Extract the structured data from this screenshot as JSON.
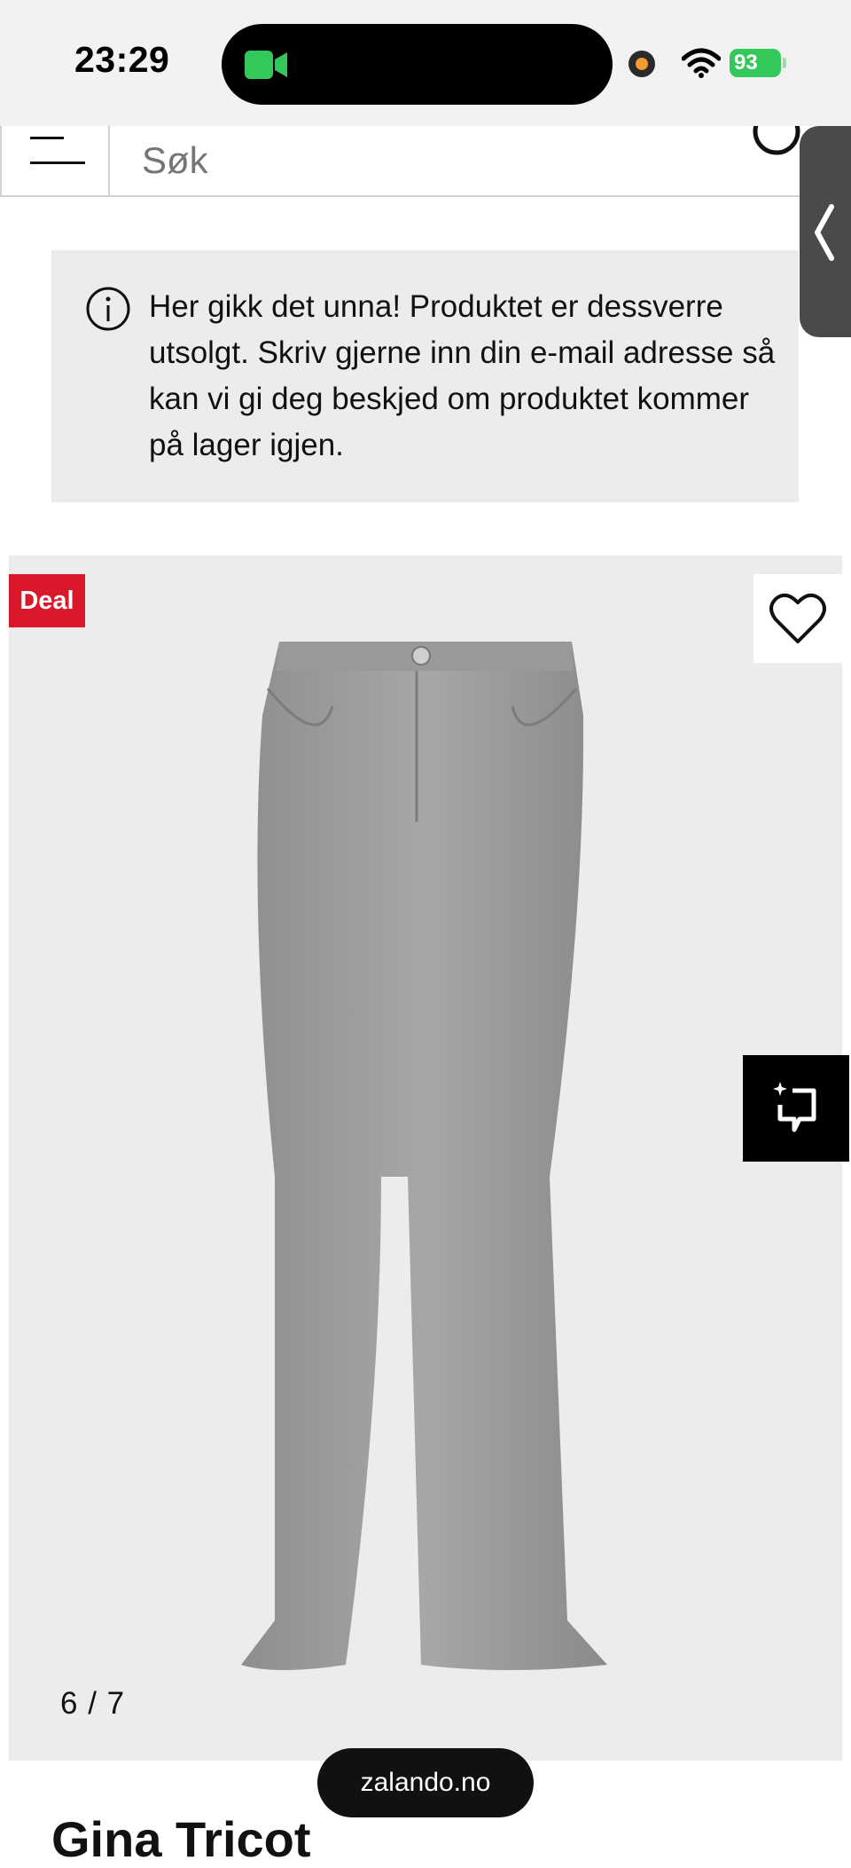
{
  "status_bar": {
    "time": "23:29",
    "battery": "93"
  },
  "search": {
    "placeholder": "Søk"
  },
  "notice": {
    "text": "Her gikk det unna! Produktet er dessverre utsolgt. Skriv gjerne inn din e-mail adresse så kan vi gi deg beskjed om produktet kommer på lager igjen."
  },
  "product": {
    "badge": "Deal",
    "image_counter": "6 / 7",
    "brand": "Gina Tricot"
  },
  "browser": {
    "url": "zalando.no"
  },
  "colors": {
    "deal_red": "#d9192a",
    "battery_green": "#34c759",
    "background_gray": "#ececec"
  },
  "icons": [
    "video-camera-icon",
    "privacy-dot-icon",
    "wifi-icon",
    "battery-icon",
    "menu-icon",
    "search-icon",
    "chevron-left-icon",
    "info-icon",
    "heart-icon",
    "visual-search-icon"
  ]
}
